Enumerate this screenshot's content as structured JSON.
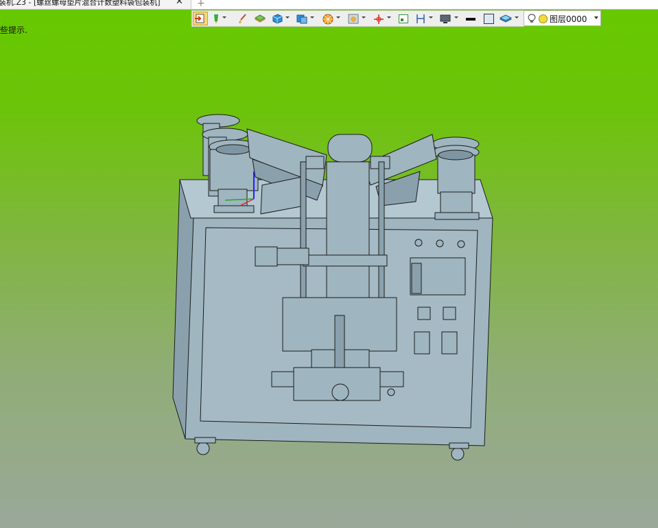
{
  "window": {
    "tab_title": "装机.Z3 - [螺丝螺母垫片混合计数塑料袋包装机]",
    "tab_close": "✕",
    "new_tab": "+"
  },
  "status": {
    "hint_text": "些提示."
  },
  "toolbar": {
    "icons": [
      "exit-sketch-icon",
      "pen-icon",
      "brush-icon",
      "layers-icon",
      "cube-icon",
      "view-cube-icon",
      "sphere-pattern-icon",
      "render-icon",
      "axis-icon",
      "grid-icon",
      "dimension-icon",
      "monitor-icon",
      "line-weight-icon",
      "color-swatch-icon",
      "layer-stack-icon"
    ]
  },
  "layer_selector": {
    "value": "图层0000",
    "bulb_icon": "light-bulb-icon",
    "color": "#f2dd3a"
  },
  "colors": {
    "bg_top": "#66c900",
    "bg_bottom": "#9aa89a",
    "model_fill": "#9fb5c0",
    "model_edge": "#1a1a1a"
  }
}
